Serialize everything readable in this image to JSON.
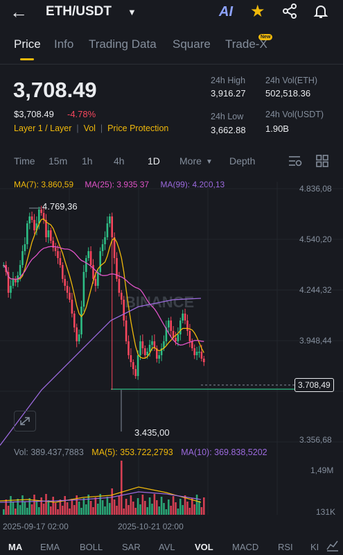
{
  "header": {
    "pair": "ETH/USDT",
    "ai_label": "AI"
  },
  "tabs": [
    "Price",
    "Info",
    "Trading Data",
    "Square",
    "Trade-X"
  ],
  "new_badge": "New",
  "price": {
    "last": "3,708.49",
    "usd": "$3,708.49",
    "change": "-4.78%",
    "tag1": "Layer 1 / Layer",
    "tag2": "Vol",
    "tag3": "Price Protection"
  },
  "stats": {
    "high_label": "24h High",
    "high": "3,916.27",
    "low_label": "24h Low",
    "low": "3,662.88",
    "vol_eth_label": "24h Vol(ETH)",
    "vol_eth": "502,518.36",
    "vol_usdt_label": "24h Vol(USDT)",
    "vol_usdt": "1.90B"
  },
  "timeframes": [
    "Time",
    "15m",
    "1h",
    "4h",
    "1D",
    "More",
    "Depth"
  ],
  "active_timeframe": "1D",
  "ma": {
    "ma7": "MA(7): 3.860,59",
    "ma25": "MA(25): 3.935,37",
    "ma99": "MA(99): 4.200,13"
  },
  "y_ticks": [
    "4.836,08",
    "4.540,20",
    "4.244,32",
    "3.948,44",
    "3.356,68"
  ],
  "current_price_tag": "3.708,49",
  "high_marker": "4.769,36",
  "low_marker": "3.435,00",
  "watermark": "BINANCE",
  "volume": {
    "vol": "Vol: 389.437,7883",
    "ma5": "MA(5): 353.722,2793",
    "ma10": "MA(10): 369.838,5202",
    "y_top": "1,49M",
    "y_bottom": "131K"
  },
  "dates": [
    "2025-09-17 02:00",
    "2025-10-21 02:00"
  ],
  "indicators": [
    "MA",
    "EMA",
    "BOLL",
    "SAR",
    "AVL",
    "VOL",
    "MACD",
    "RSI",
    "KI"
  ],
  "colors": {
    "up": "#2ebd85",
    "down": "#f6465d",
    "accent": "#f0b90b",
    "ma7": "#f0b90b",
    "ma25": "#e054c8",
    "ma99": "#9c6ade"
  }
}
